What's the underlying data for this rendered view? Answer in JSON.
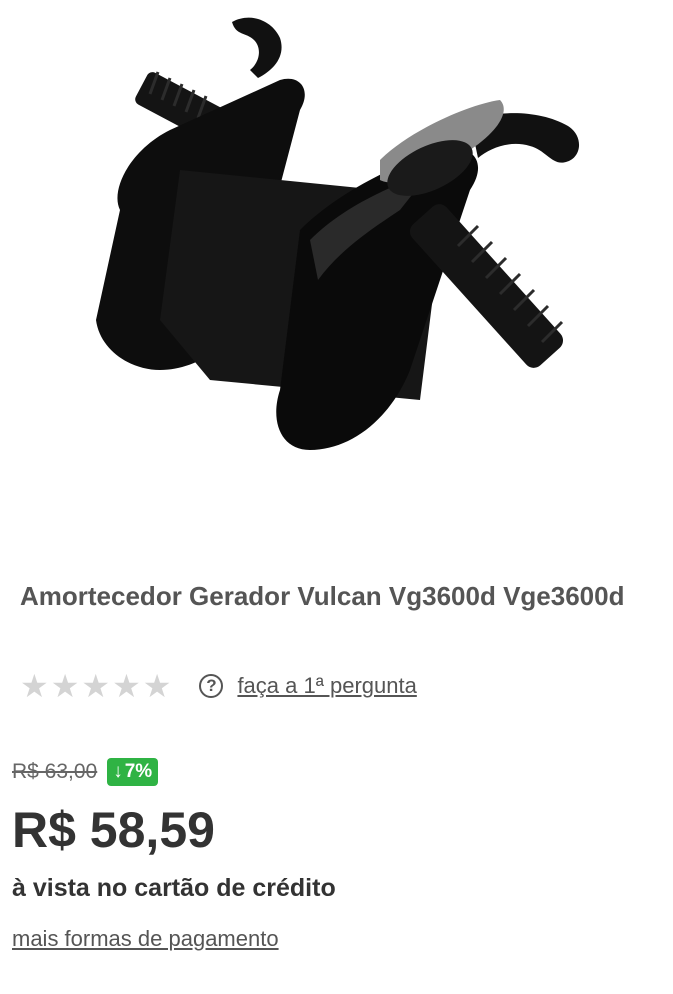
{
  "product": {
    "image_alt_icon": "rubber-mount-image",
    "title": "Amortecedor Gerador Vulcan Vg3600d Vge3600d",
    "rating": {
      "stars_filled": 0,
      "stars_total": 5,
      "question_link": "faça a 1ª pergunta"
    },
    "pricing": {
      "old_price": "R$ 63,00",
      "discount": "7%",
      "price": "R$ 58,59",
      "payment_note": "à vista no cartão de crédito",
      "more_payments_link": "mais formas de pagamento"
    }
  },
  "colors": {
    "star_empty": "#d4d4d4",
    "discount_green": "#2fb344",
    "text_dark": "#333333"
  }
}
